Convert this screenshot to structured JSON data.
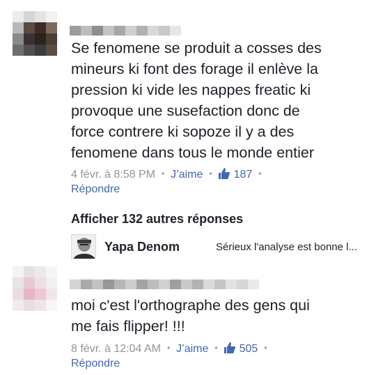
{
  "comments": [
    {
      "text": "Se fenomene se produit a cosses des\nmineurs ki font des forage il enlève la\npression ki vide les nappes freatic ki\nprovoque une susefaction donc de\nforce contrere ki sopoze il y a des\nfenomene dans tous le monde entier",
      "timestamp": "4 févr. à 8:58 PM",
      "like_label": "J’aime",
      "like_count": "187",
      "reply_label": "Répondre"
    },
    {
      "text": "moi c'est l'orthographe des gens qui\nme fais flipper! !!!",
      "timestamp": "8 févr. à 12:04 AM",
      "like_label": "J’aime",
      "like_count": "505",
      "reply_label": "Répondre"
    }
  ],
  "replies": {
    "more_label": "Afficher 132 autres réponses",
    "preview_name": "Yapa Denom",
    "preview_snippet": "Sérieux l'analyse est bonne l..."
  },
  "separator": "•",
  "icons": {
    "like": "thumbs-up-icon"
  },
  "colors": {
    "link": "#4267b2",
    "meta": "#90949c",
    "text": "#1d2129"
  }
}
